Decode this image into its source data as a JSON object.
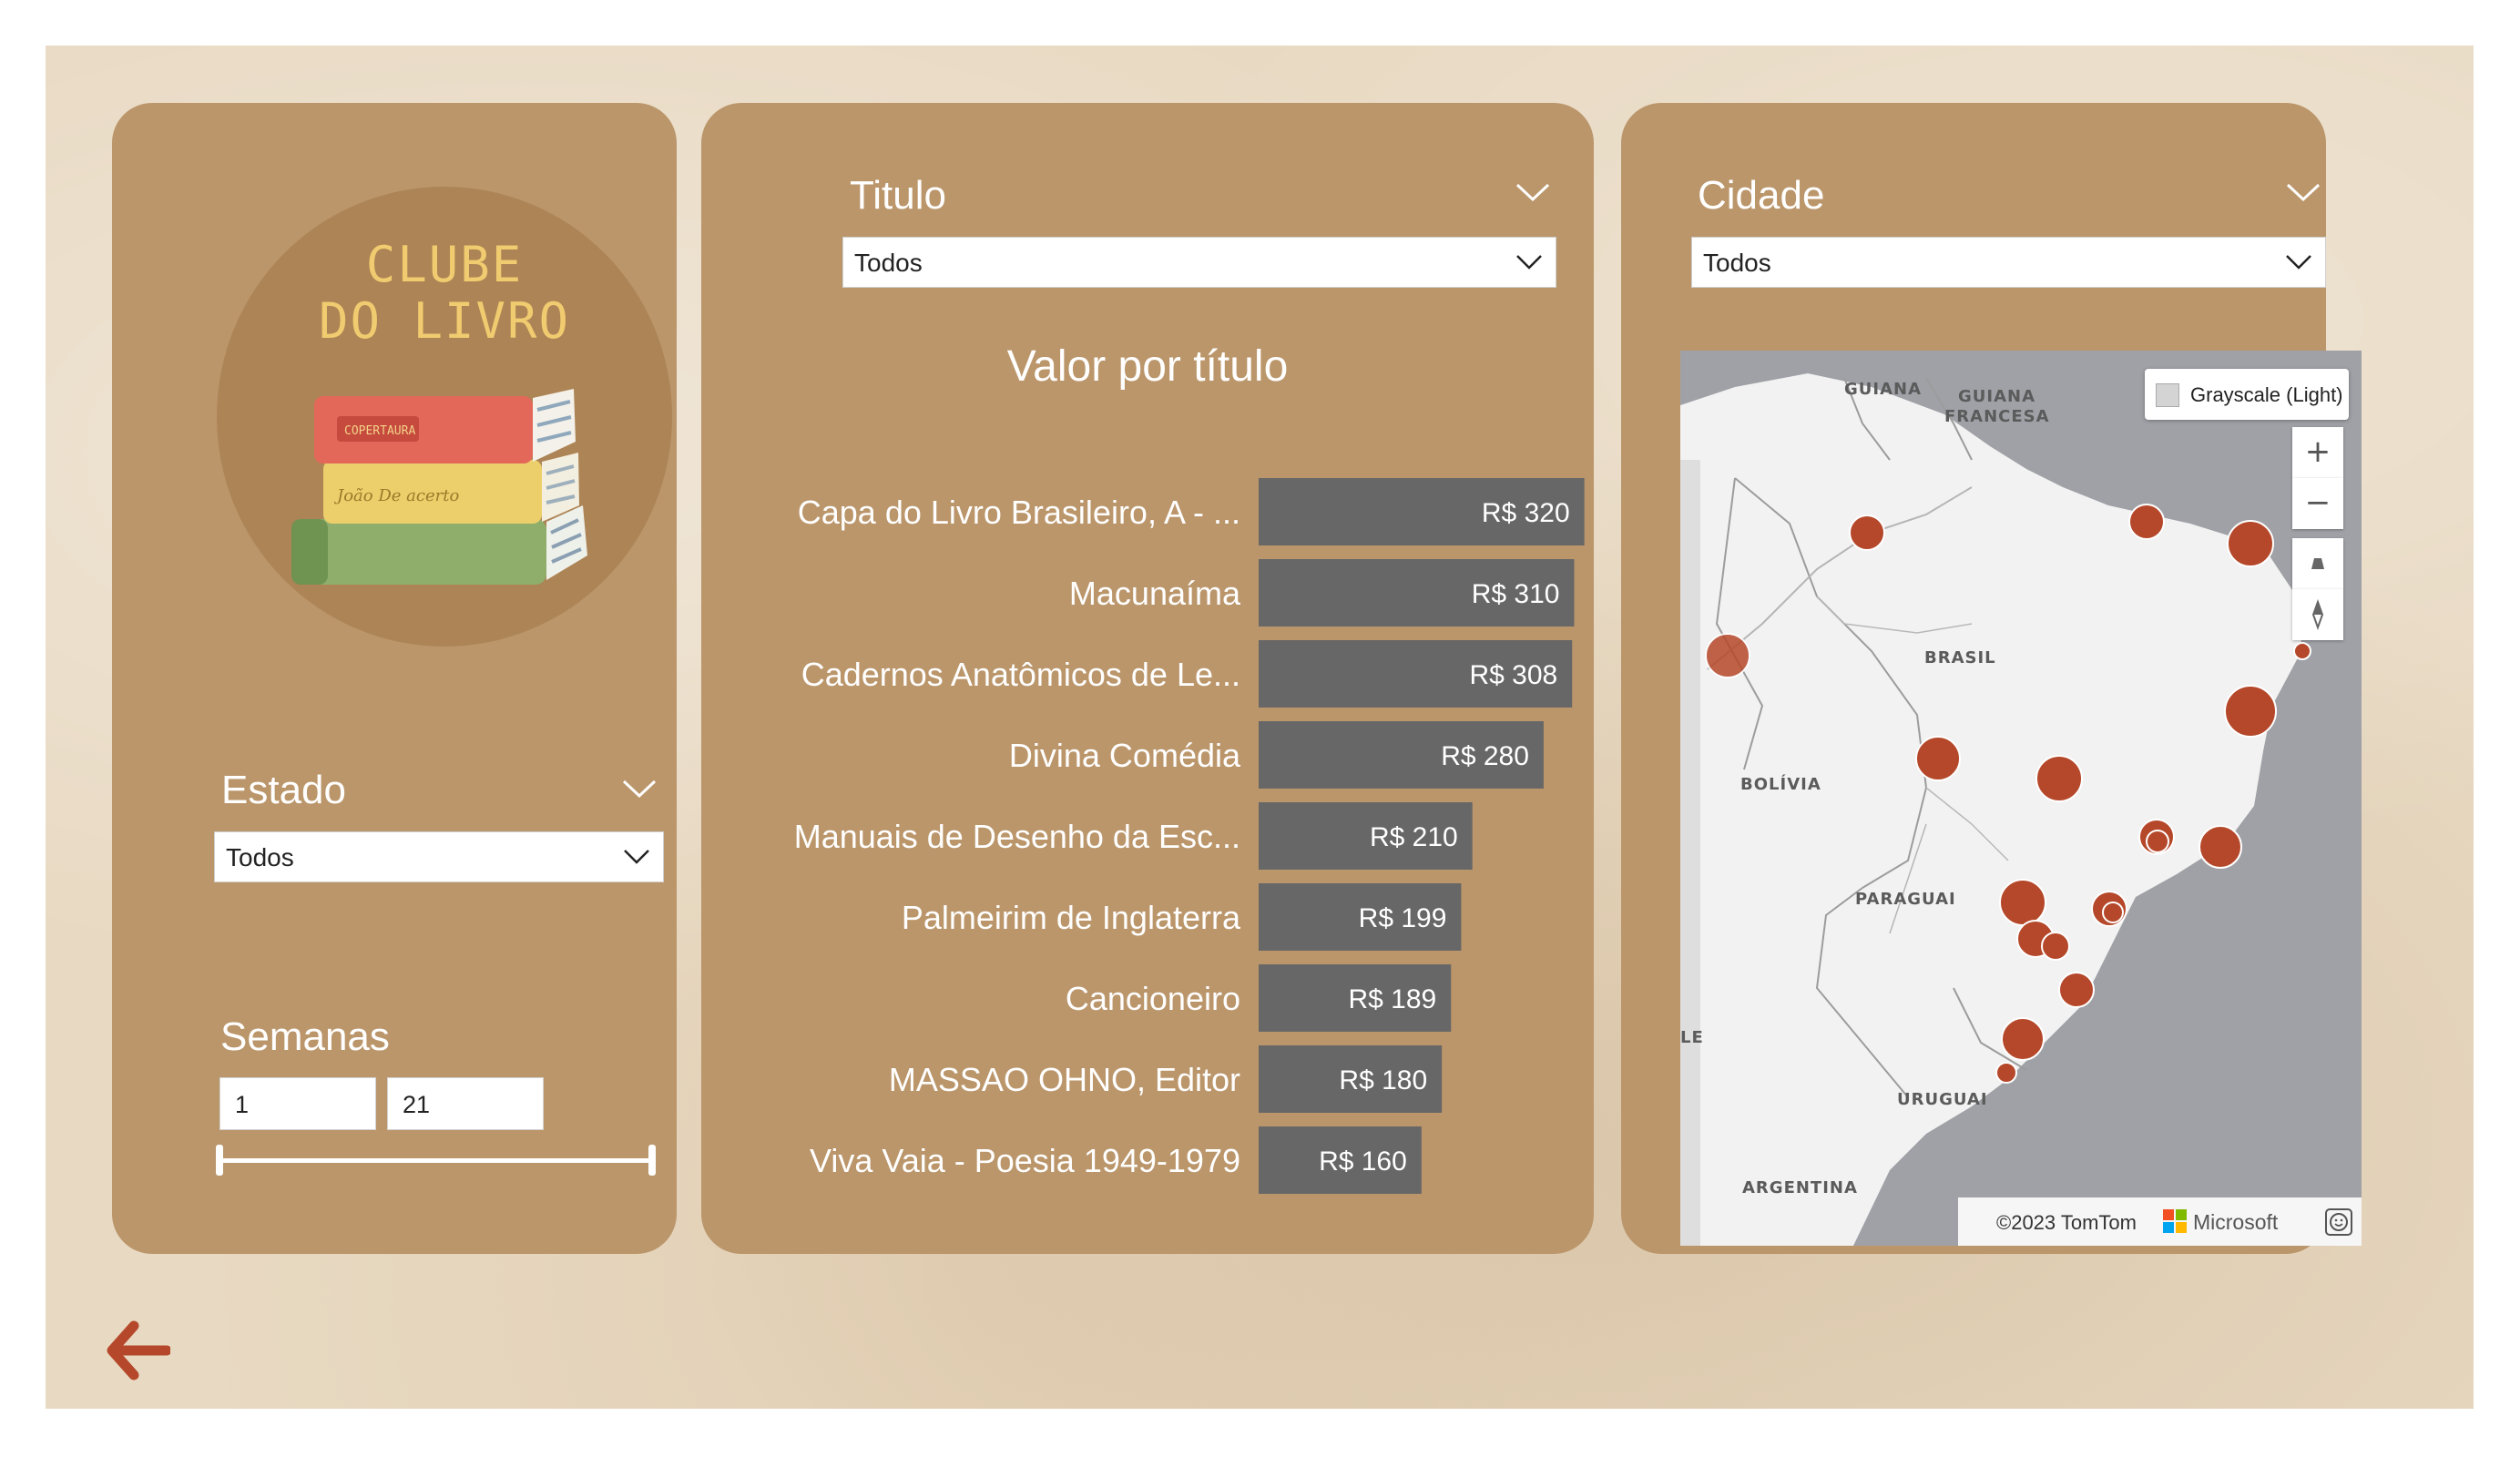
{
  "logo": {
    "line1": "CLUBE",
    "line2": "DO LIVRO",
    "book1_text": "COPERTAURA",
    "book2_text": "João De acerto"
  },
  "estado": {
    "label": "Estado",
    "value": "Todos"
  },
  "semanas": {
    "label": "Semanas",
    "min": "1",
    "max": "21"
  },
  "titulo": {
    "label": "Titulo",
    "value": "Todos"
  },
  "cidade": {
    "label": "Cidade",
    "value": "Todos"
  },
  "chart_data": {
    "type": "bar",
    "orientation": "horizontal",
    "title": "Valor por título",
    "categories": [
      "Capa do Livro Brasileiro, A - ...",
      "Macunaíma",
      "Cadernos Anatômicos de Le...",
      "Divina Comédia",
      "Manuais de Desenho da Esc...",
      "Palmeirim de Inglaterra",
      "Cancioneiro",
      "MASSAO OHNO, Editor",
      "Viva Vaia - Poesia 1949-1979"
    ],
    "values": [
      320,
      310,
      308,
      280,
      210,
      199,
      189,
      180,
      160
    ],
    "data_labels": [
      "R$ 320",
      "R$ 310",
      "R$ 308",
      "R$ 280",
      "R$ 210",
      "R$ 199",
      "R$ 189",
      "R$ 180",
      "R$ 160"
    ],
    "bar_color": "#676767"
  },
  "map": {
    "style_label": "Grayscale (Light)",
    "zoom_in": "+",
    "zoom_out": "−",
    "attribution": "©2023 TomTom",
    "brand": "Microsoft",
    "labels": [
      "GUIANA",
      "GUIANA",
      "FRANCESA",
      "BRASIL",
      "BOLÍVIA",
      "PARAGUAI",
      "URUGUAI",
      "ARGENTINA",
      "LE"
    ],
    "marker_color": "#b5482a"
  },
  "colors": {
    "panel": "#bb966b",
    "background": "#e8d9c2",
    "accent": "#b5482a"
  },
  "icons": {
    "back": "back-arrow-icon"
  }
}
